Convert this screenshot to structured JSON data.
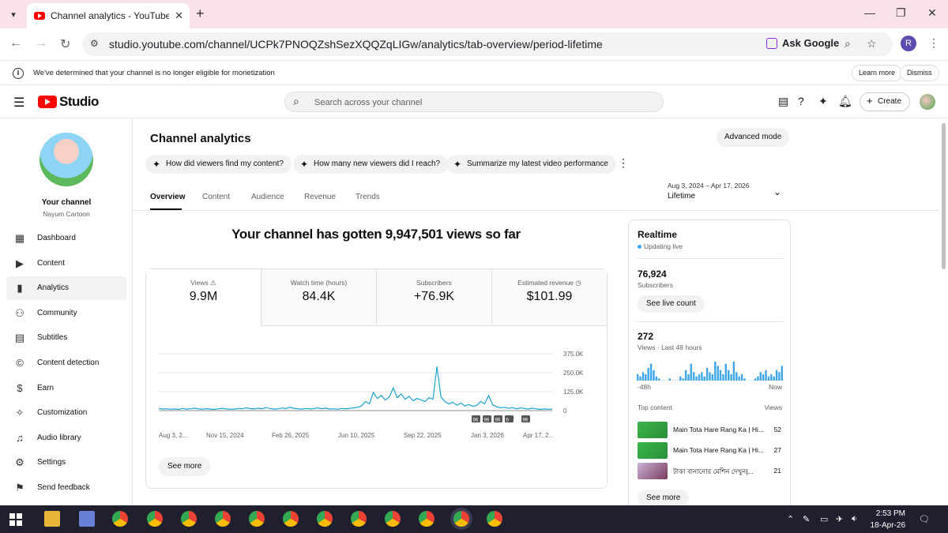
{
  "browser": {
    "tab_title": "Channel analytics - YouTube Stu",
    "url": "studio.youtube.com/channel/UCPk7PNOQZshSezXQQZqLIGw/analytics/tab-overview/period-lifetime",
    "ask_google": "Ask Google",
    "profile_initial": "R"
  },
  "notice": {
    "message": "We've determined that your channel is no longer eligible for monetization",
    "learn_more": "Learn more",
    "dismiss": "Dismiss"
  },
  "header": {
    "brand": "Studio",
    "search_placeholder": "Search across your channel",
    "create_label": "Create"
  },
  "sidebar": {
    "channel_title": "Your channel",
    "channel_name": "Nayum Cartoon",
    "items": [
      {
        "label": "Dashboard",
        "icon": "dashboard-icon"
      },
      {
        "label": "Content",
        "icon": "content-icon"
      },
      {
        "label": "Analytics",
        "icon": "analytics-icon"
      },
      {
        "label": "Community",
        "icon": "community-icon"
      },
      {
        "label": "Subtitles",
        "icon": "subtitles-icon"
      },
      {
        "label": "Content detection",
        "icon": "copyright-icon"
      },
      {
        "label": "Earn",
        "icon": "dollar-icon"
      },
      {
        "label": "Customization",
        "icon": "wand-icon"
      },
      {
        "label": "Audio library",
        "icon": "audio-library-icon"
      },
      {
        "label": "Settings",
        "icon": "gear-icon"
      },
      {
        "label": "Send feedback",
        "icon": "feedback-icon"
      }
    ]
  },
  "main": {
    "title": "Channel analytics",
    "advanced_mode": "Advanced mode",
    "chips": [
      "How did viewers find my content?",
      "How many new viewers did I reach?",
      "Summarize my latest video performance"
    ],
    "tabs": [
      "Overview",
      "Content",
      "Audience",
      "Revenue",
      "Trends"
    ],
    "period_range": "Aug 3, 2024 – Apr 17, 2026",
    "period_label": "Lifetime",
    "headline": "Your channel has gotten 9,947,501 views so far",
    "metrics": [
      {
        "label": "Views",
        "value": "9.9M"
      },
      {
        "label": "Watch time (hours)",
        "value": "84.4K"
      },
      {
        "label": "Subscribers",
        "value": "+76.9K"
      },
      {
        "label": "Estimated revenue",
        "value": "$101.99"
      }
    ],
    "see_more": "See more"
  },
  "chart_data": {
    "type": "line",
    "x_ticks": [
      "Aug 3, 2...",
      "Nov 15, 2024",
      "Feb 26, 2025",
      "Jun 10, 2025",
      "Sep 22, 2025",
      "Jan 3, 2026",
      "Apr 17, 2..."
    ],
    "y_ticks": [
      "375.0K",
      "250.0K",
      "125.0K",
      "0"
    ],
    "ylim": [
      0,
      375000
    ],
    "series": [
      {
        "color": "#1aa3d1",
        "values": [
          15000,
          10000,
          12000,
          9000,
          11000,
          8000,
          14000,
          10000,
          12000,
          16000,
          11000,
          9000,
          13000,
          10000,
          8000,
          12000,
          15000,
          11000,
          9000,
          10000,
          14000,
          12000,
          18000,
          13000,
          11000,
          16000,
          12000,
          20000,
          14000,
          10000,
          12000,
          17000,
          13000,
          22000,
          15000,
          12000,
          10000,
          14000,
          11000,
          13000,
          18000,
          12000,
          16000,
          10000,
          12000,
          9000,
          14000,
          11000,
          15000,
          18000,
          22000,
          30000,
          60000,
          45000,
          120000,
          80000,
          100000,
          70000,
          90000,
          150000,
          85000,
          110000,
          75000,
          95000,
          65000,
          80000,
          70000,
          60000,
          85000,
          75000,
          290000,
          90000,
          60000,
          45000,
          55000,
          35000,
          50000,
          30000,
          40000,
          28000,
          35000,
          60000,
          45000,
          100000,
          40000,
          25000,
          18000,
          22000,
          15000,
          20000,
          12000,
          18000,
          14000,
          10000,
          16000,
          12000,
          8000,
          11000,
          9000,
          10000
        ]
      }
    ],
    "markers": [
      "96",
      "96",
      "96",
      "6",
      "96"
    ]
  },
  "realtime": {
    "title": "Realtime",
    "status": "Updating live",
    "subscribers_value": "76,924",
    "subscribers_label": "Subscribers",
    "see_live_count": "See live count",
    "views_value": "272",
    "views_label": "Views · Last 48 hours",
    "hist_start": "-48h",
    "hist_end": "Now",
    "hist_values": [
      3,
      2,
      4,
      3,
      6,
      8,
      5,
      2,
      1,
      0,
      0,
      0,
      1,
      0,
      0,
      0,
      2,
      1,
      5,
      3,
      8,
      4,
      2,
      3,
      4,
      2,
      6,
      4,
      3,
      9,
      7,
      5,
      3,
      8,
      5,
      3,
      9,
      4,
      2,
      3,
      1,
      0,
      0,
      0,
      1,
      2,
      4,
      3,
      5,
      2,
      3,
      2,
      5,
      4,
      7
    ],
    "top_content_label": "Top content",
    "views_col": "Views",
    "top_content": [
      {
        "title": "Main Tota Hare Rang Ka | Hi...",
        "views": "52"
      },
      {
        "title": "Main Tota Hare Rang Ka | Hi...",
        "views": "27"
      },
      {
        "title": "টাকা বানানোর মেশিন দেখুন|...",
        "views": "21"
      }
    ],
    "see_more": "See more"
  },
  "taskbar": {
    "time": "2:53 PM",
    "date": "18-Apr-26"
  }
}
